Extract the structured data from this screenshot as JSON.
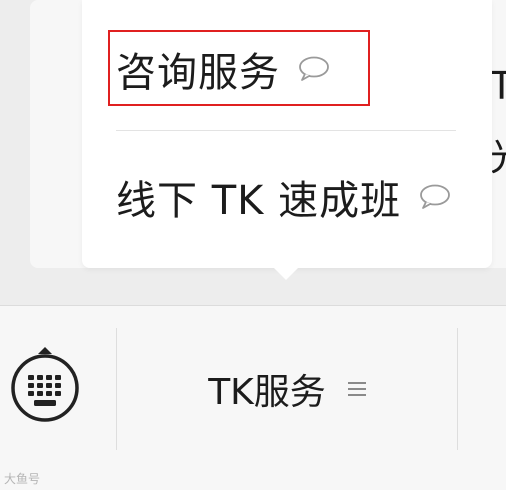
{
  "menu": {
    "items": [
      {
        "label": "咨询服务",
        "icon": "chat-bubble-icon"
      },
      {
        "label": "线下 TK 速成班",
        "icon": "chat-bubble-icon"
      }
    ]
  },
  "background": {
    "line1": "T",
    "line2": "光"
  },
  "bottom_bar": {
    "keyboard_icon": "keyboard-toggle-icon",
    "service_tab_label": "TK服务",
    "service_tab_icon": "hamburger-menu-icon"
  },
  "watermark": "大鱼号",
  "colors": {
    "highlight": "#e02020",
    "menu_bg": "#ffffff",
    "bar_bg": "#f7f7f7",
    "text": "#1c1c1c"
  }
}
